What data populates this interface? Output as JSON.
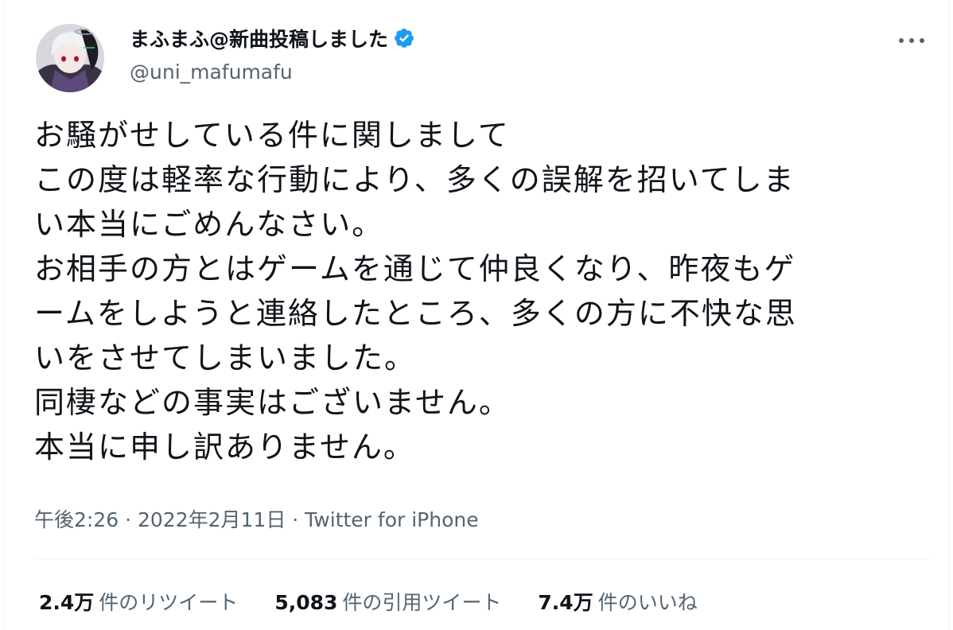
{
  "author": {
    "display_name": "まふまふ@新曲投稿しました",
    "handle": "@uni_mafumafu",
    "verified": true,
    "avatar_icon": "avatar-icon"
  },
  "more_icon": "more-horizontal-icon",
  "tweet": {
    "lines": [
      "お騒がせしている件に関しまして",
      "この度は軽率な行動により、多くの誤解を招いてしま",
      "い本当にごめんなさい。",
      "お相手の方とはゲームを通じて仲良くなり、昨夜もゲ",
      "ームをしようと連絡したところ、多くの方に不快な思",
      "いをさせてしまいました。",
      "同棲などの事実はございません。",
      "本当に申し訳ありません。"
    ]
  },
  "meta": {
    "time": "午後2:26",
    "sep1": " · ",
    "date": "2022年2月11日",
    "sep2": " · ",
    "source": "Twitter for iPhone"
  },
  "stats": {
    "retweets": {
      "count": "2.4万",
      "label": "件のリツイート"
    },
    "quotes": {
      "count": "5,083",
      "label": "件の引用ツイート"
    },
    "likes": {
      "count": "7.4万",
      "label": "件のいいね"
    }
  },
  "colors": {
    "text": "#0f1419",
    "secondary": "#536471",
    "verified": "#1d9bf0",
    "divider": "#eff3f4"
  }
}
